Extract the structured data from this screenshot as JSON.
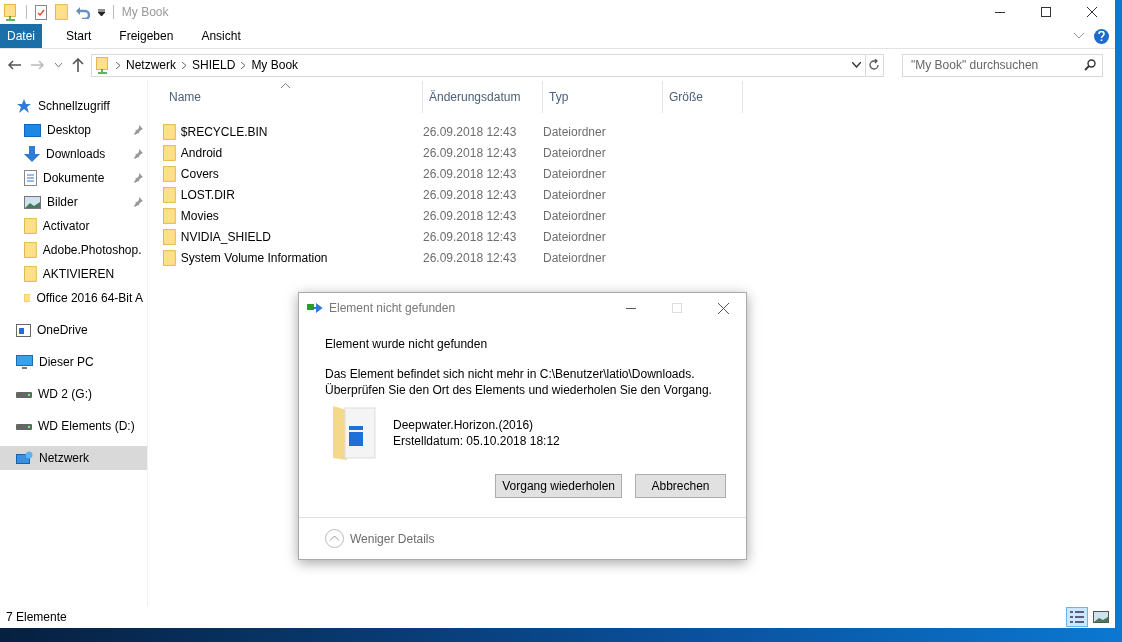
{
  "window": {
    "title": "My Book"
  },
  "ribbon": {
    "tabs": [
      {
        "label": "Datei",
        "selected": true
      },
      {
        "label": "Start",
        "selected": false
      },
      {
        "label": "Freigeben",
        "selected": false
      },
      {
        "label": "Ansicht",
        "selected": false
      }
    ]
  },
  "address": {
    "crumbs": [
      "Netzwerk",
      "SHIELD",
      "My Book"
    ]
  },
  "search": {
    "placeholder": "\"My Book\" durchsuchen"
  },
  "sidebar": {
    "items": [
      {
        "label": "Schnellzugriff",
        "kind": "star",
        "pinned": false,
        "selected": false
      },
      {
        "label": "Desktop",
        "kind": "desktop",
        "pinned": true,
        "selected": false
      },
      {
        "label": "Downloads",
        "kind": "download",
        "pinned": true,
        "selected": false
      },
      {
        "label": "Dokumente",
        "kind": "document",
        "pinned": true,
        "selected": false
      },
      {
        "label": "Bilder",
        "kind": "picture",
        "pinned": true,
        "selected": false
      },
      {
        "label": "Activator",
        "kind": "folder",
        "pinned": false,
        "selected": false
      },
      {
        "label": "Adobe.Photoshop.",
        "kind": "folder",
        "pinned": false,
        "selected": false
      },
      {
        "label": "AKTIVIEREN",
        "kind": "folder",
        "pinned": false,
        "selected": false
      },
      {
        "label": "Office 2016 64-Bit A",
        "kind": "folder",
        "pinned": false,
        "selected": false
      },
      {
        "label": "OneDrive",
        "kind": "cloud",
        "pinned": false,
        "selected": false
      },
      {
        "label": "Dieser PC",
        "kind": "pc",
        "pinned": false,
        "selected": false
      },
      {
        "label": "WD 2 (G:)",
        "kind": "drive",
        "pinned": false,
        "selected": false
      },
      {
        "label": "WD Elements (D:)",
        "kind": "drive",
        "pinned": false,
        "selected": false
      },
      {
        "label": "Netzwerk",
        "kind": "network",
        "pinned": false,
        "selected": true
      }
    ]
  },
  "table": {
    "columns": [
      {
        "label": "Name",
        "sorted": true
      },
      {
        "label": "Änderungsdatum",
        "sorted": false
      },
      {
        "label": "Typ",
        "sorted": false
      },
      {
        "label": "Größe",
        "sorted": false
      }
    ],
    "rows": [
      {
        "name": "$RECYCLE.BIN",
        "date": "26.09.2018 12:43",
        "type": "Dateiordner"
      },
      {
        "name": "Android",
        "date": "26.09.2018 12:43",
        "type": "Dateiordner"
      },
      {
        "name": "Covers",
        "date": "26.09.2018 12:43",
        "type": "Dateiordner"
      },
      {
        "name": "LOST.DIR",
        "date": "26.09.2018 12:43",
        "type": "Dateiordner"
      },
      {
        "name": "Movies",
        "date": "26.09.2018 12:43",
        "type": "Dateiordner"
      },
      {
        "name": "NVIDIA_SHIELD",
        "date": "26.09.2018 12:43",
        "type": "Dateiordner"
      },
      {
        "name": "System Volume Information",
        "date": "26.09.2018 12:43",
        "type": "Dateiordner"
      }
    ]
  },
  "status_bar": {
    "count": "7 Elemente",
    "views": [
      {
        "kind": "details",
        "selected": true
      },
      {
        "kind": "tiles",
        "selected": false
      }
    ]
  },
  "dialog": {
    "title": "Element nicht gefunden",
    "heading": "Element wurde nicht gefunden",
    "message_lines": [
      "Das Element befindet sich nicht mehr in C:\\Benutzer\\latio\\Downloads.",
      "Überprüfen Sie den Ort des Elements und wiederholen Sie den Vorgang."
    ],
    "file_name": "Deepwater.Horizon.(2016)",
    "file_created": "Erstelldatum: 05.10.2018 18:12",
    "buttons": [
      "Vorgang wiederholen",
      "Abbrechen"
    ],
    "maximize_disabled": true,
    "details_toggle": "Weniger Details"
  }
}
